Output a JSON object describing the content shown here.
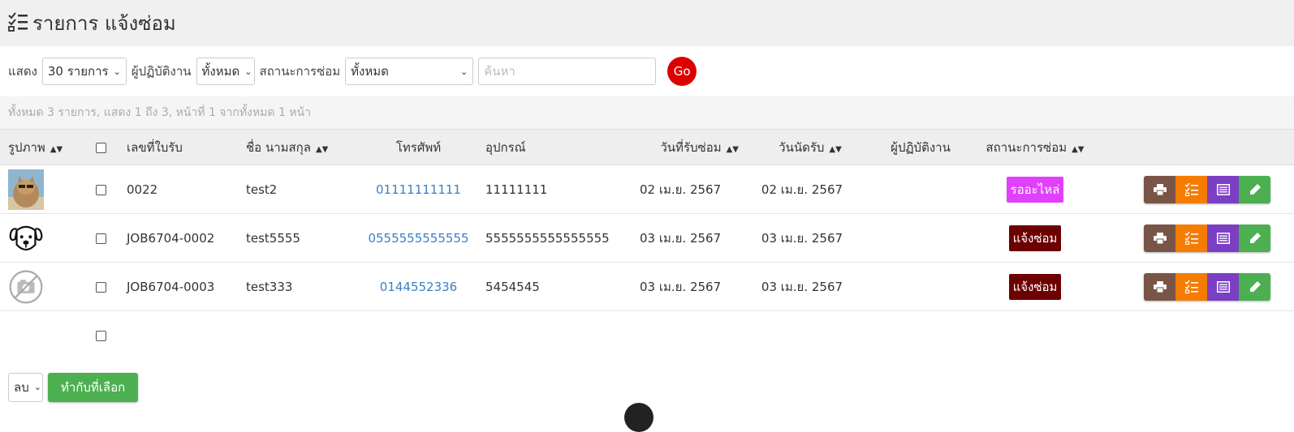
{
  "header": {
    "title": "รายการ แจ้งซ่อม",
    "icon": "checklist-icon"
  },
  "filters": {
    "show_label": "แสดง",
    "show_value": "30 รายการ",
    "operator_label": "ผู้ปฏิบัติงาน",
    "operator_value": "ทั้งหมด",
    "status_label": "สถานะการซ่อม",
    "status_value": "ทั้งหมด",
    "search_placeholder": "ค้นหา",
    "go_label": "Go"
  },
  "summary": "ทั้งหมด 3 รายการ, แสดง 1 ถึง 3, หน้าที่ 1 จากทั้งหมด 1 หน้า",
  "columns": {
    "image": "รูปภาพ",
    "receipt": "เลขที่ใบรับ",
    "name": "ชื่อ นามสกุล",
    "phone": "โทรศัพท์",
    "device": "อุปกรณ์",
    "received_date": "วันที่รับซ่อม",
    "appointment_date": "วันนัดรับ",
    "operator": "ผู้ปฏิบัติงาน",
    "status": "สถานะการซ่อม"
  },
  "rows": [
    {
      "image": "cat-photo",
      "receipt": "0022",
      "name": "test2",
      "phone": "01111111111",
      "device": "11111111",
      "received": "02 เม.ย. 2567",
      "appointment": "02 เม.ย. 2567",
      "operator": "",
      "status": "รออะไหล่",
      "status_color": "#e040fb"
    },
    {
      "image": "dog-icon",
      "receipt": "JOB6704-0002",
      "name": "test5555",
      "phone": "0555555555555",
      "device": "5555555555555555",
      "received": "03 เม.ย. 2567",
      "appointment": "03 เม.ย. 2567",
      "operator": "",
      "status": "แจ้งซ่อม",
      "status_color": "#6d0000"
    },
    {
      "image": "no-image-icon",
      "receipt": "JOB6704-0003",
      "name": "test333",
      "phone": "0144552336",
      "device": "5454545",
      "received": "03 เม.ย. 2567",
      "appointment": "03 เม.ย. 2567",
      "operator": "",
      "status": "แจ้งซ่อม",
      "status_color": "#6d0000"
    }
  ],
  "actions": {
    "print_color": "#795548",
    "checklist_color": "#f57c00",
    "detail_color": "#7b3fc4",
    "edit_color": "#4caf50"
  },
  "bulk": {
    "action_value": "ลบ",
    "apply_label": "ทำกับที่เลือก"
  },
  "colors": {
    "header_bg": "#f0f0f0",
    "go_button": "#dd0000",
    "phone_link": "#3a7fc4"
  }
}
